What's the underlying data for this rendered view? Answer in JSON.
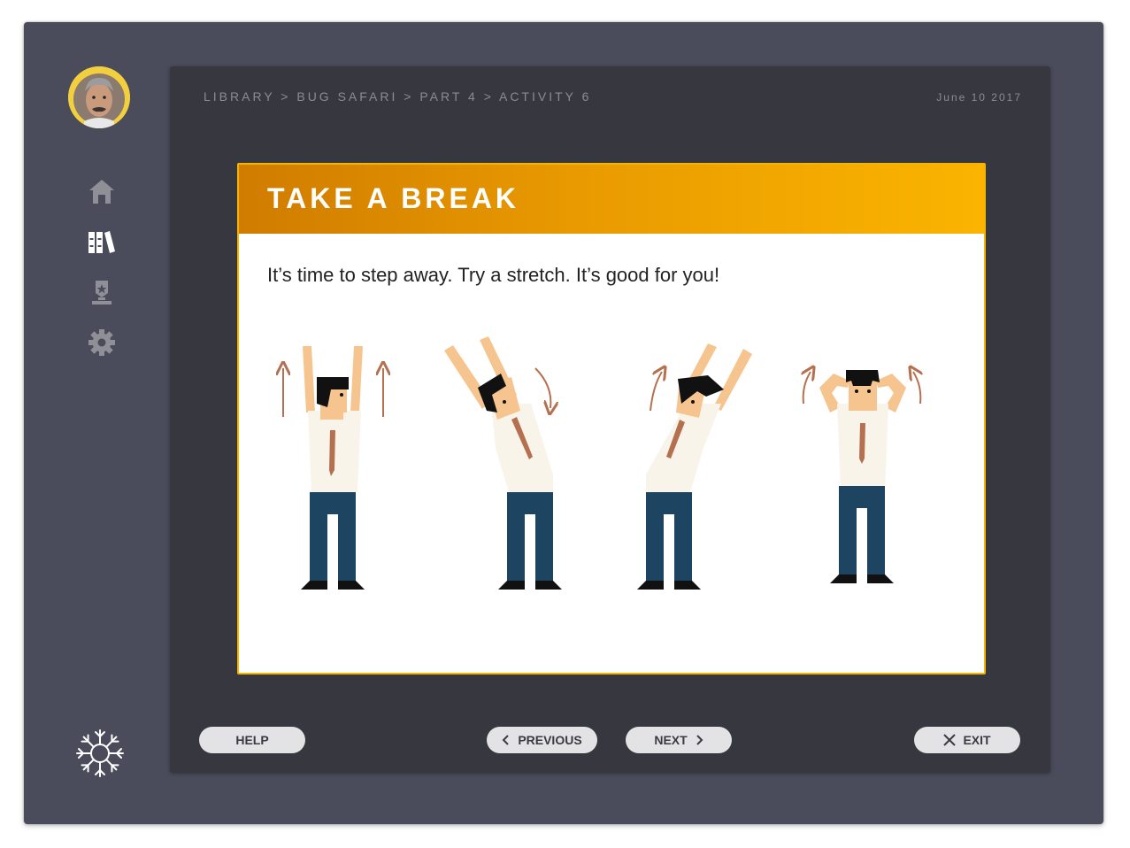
{
  "breadcrumb": "LIBRARY > BUG SAFARI > PART 4  > ACTIVITY 6",
  "date": "June 10 2017",
  "card": {
    "title": "TAKE A BREAK",
    "body": "It’s time to step away. Try a stretch. It’s good for you!"
  },
  "sidebar": {
    "items": [
      {
        "icon": "home-icon"
      },
      {
        "icon": "library-icon"
      },
      {
        "icon": "award-icon"
      },
      {
        "icon": "gear-icon"
      }
    ],
    "logo_icon": "snowflake-icon"
  },
  "buttons": {
    "help": "HELP",
    "previous": "PREVIOUS",
    "next": "NEXT",
    "exit": "EXIT"
  },
  "colors": {
    "frame": "#4a4c5c",
    "panel": "#37383f",
    "accent": "#f4b400",
    "button_bg": "#e3e3e6"
  }
}
